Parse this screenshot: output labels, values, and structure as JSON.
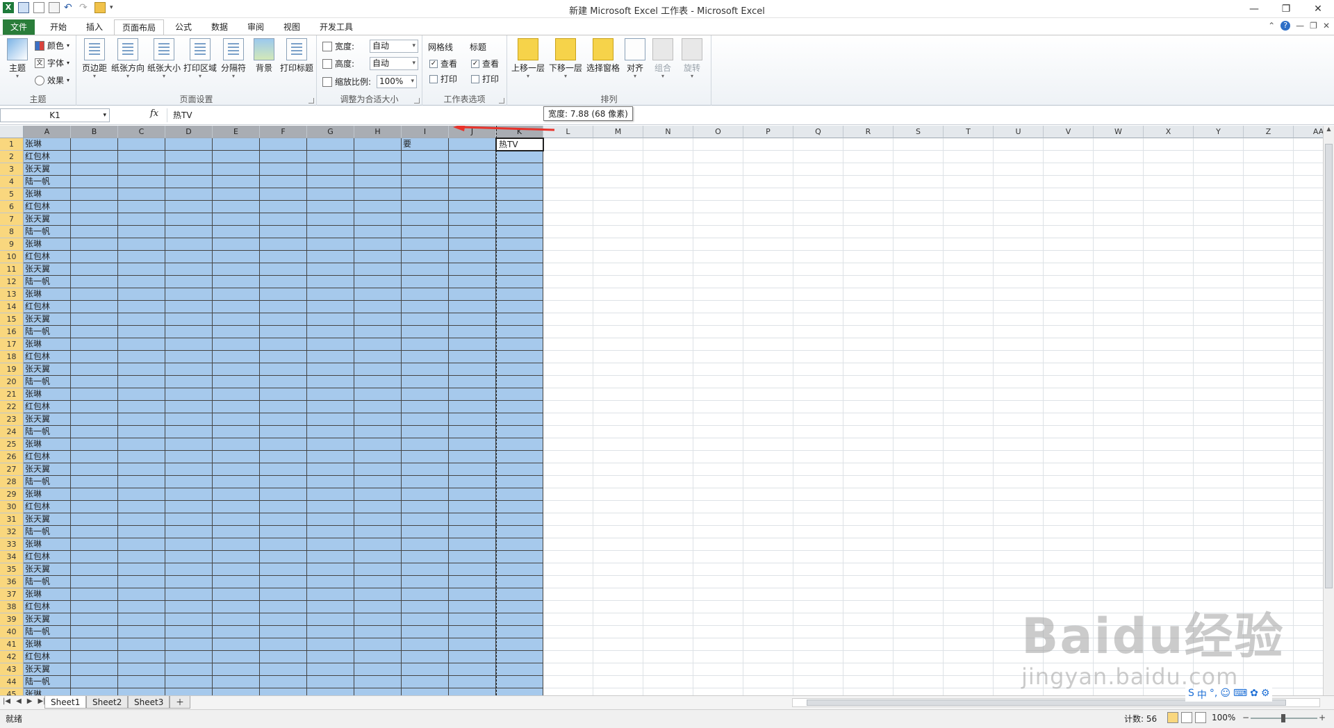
{
  "app": {
    "title": "新建 Microsoft Excel 工作表 - Microsoft Excel"
  },
  "window": {
    "minimize": "—",
    "restore": "❐",
    "close": "✕"
  },
  "ribbon": {
    "tabs": [
      "文件",
      "开始",
      "插入",
      "页面布局",
      "公式",
      "数据",
      "审阅",
      "视图",
      "开发工具"
    ],
    "active_tab": "页面布局",
    "groups": {
      "theme": {
        "label": "主题",
        "theme_button": "主题",
        "colors": "颜色",
        "fonts": "字体",
        "effects": "效果"
      },
      "page_setup": {
        "label": "页面设置",
        "buttons": [
          "页边距",
          "纸张方向",
          "纸张大小",
          "打印区域",
          "分隔符",
          "背景",
          "打印标题"
        ]
      },
      "scale": {
        "label": "调整为合适大小",
        "width_label": "宽度:",
        "width_value": "自动",
        "height_label": "高度:",
        "height_value": "自动",
        "zoom_label": "缩放比例:",
        "zoom_value": "100%"
      },
      "sheet_options": {
        "label": "工作表选项",
        "gridlines": "网格线",
        "headings": "标题",
        "view": "查看",
        "print": "打印"
      },
      "arrange": {
        "label": "排列",
        "buttons": [
          "上移一层",
          "下移一层",
          "选择窗格",
          "对齐",
          "组合",
          "旋转"
        ]
      }
    }
  },
  "formula_bar": {
    "name_box": "K1",
    "fx": "fx",
    "formula": "热TV"
  },
  "tooltip": "宽度: 7.88 (68 像素)",
  "grid": {
    "columns": [
      "A",
      "B",
      "C",
      "D",
      "E",
      "F",
      "G",
      "H",
      "I",
      "J",
      "K",
      "L",
      "M",
      "N",
      "O",
      "P",
      "Q",
      "R",
      "S",
      "T",
      "U",
      "V",
      "W",
      "X",
      "Y",
      "Z",
      "AA"
    ],
    "row_count": 45,
    "cycle": [
      "张琳",
      "红包林",
      "张天翼",
      "陆一帆"
    ],
    "row1": {
      "A": "张琳",
      "I": "要",
      "K": "热TV"
    }
  },
  "sheets": [
    "Sheet1",
    "Sheet2",
    "Sheet3"
  ],
  "status": {
    "ready": "就绪",
    "count": "计数: 56",
    "zoom": "100%"
  },
  "watermark": {
    "line1": "Baidu经验",
    "line2": "jingyan.baidu.com"
  },
  "colors": {
    "selection": "#a6c9ec",
    "active_tab_file": "#2a7d3a",
    "row_header_selected": "#f9d77e"
  }
}
